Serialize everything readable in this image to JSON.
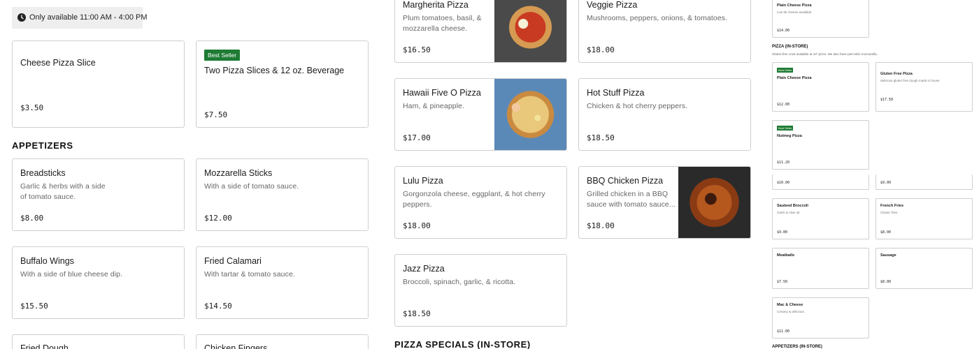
{
  "availability": {
    "text": "Only available 11:00 AM - 4:00 PM",
    "icon": "clock-icon"
  },
  "colors": {
    "badge_green": "#1e7b34",
    "border": "#cfcfcf",
    "availability_bg": "#eeeeee"
  },
  "specials": {
    "item1": {
      "name": "Cheese Pizza Slice",
      "price": "$3.50"
    },
    "item2": {
      "badge": "Best Seller",
      "name": "Two Pizza Slices & 12 oz. Beverage",
      "price": "$7.50"
    }
  },
  "appetizers": {
    "title": "APPETIZERS",
    "items": [
      {
        "name": "Breadsticks",
        "desc1": "Garlic & herbs with a side",
        "desc2": "of tomato sauce.",
        "price": "$8.00"
      },
      {
        "name": "Mozzarella Sticks",
        "desc1": "With a side of tomato sauce.",
        "price": "$12.00"
      },
      {
        "name": "Buffalo Wings",
        "desc1": "With a side of blue cheese dip.",
        "price": "$15.50"
      },
      {
        "name": "Fried Calamari",
        "desc1": "With tartar & tomato sauce.",
        "price": "$14.50"
      },
      {
        "name": "Fried Dough"
      },
      {
        "name": "Chicken Fingers"
      }
    ]
  },
  "pizzas": {
    "items": [
      {
        "name": "Margherita Pizza",
        "desc1": "Plum tomatoes, basil, &",
        "desc2": "mozzarella cheese.",
        "price": "$16.50"
      },
      {
        "name": "Veggie Pizza",
        "desc1": "Mushrooms, peppers, onions, & tomatoes.",
        "price": "$18.00"
      },
      {
        "name": "Hawaii Five O Pizza",
        "desc1": "Ham, & pineapple.",
        "price": "$17.00"
      },
      {
        "name": "Hot Stuff Pizza",
        "desc1": "Chicken & hot cherry peppers.",
        "price": "$18.50"
      },
      {
        "name": "Lulu Pizza",
        "desc1": "Gorgonzola cheese, eggplant, & hot cherry",
        "desc2": "peppers.",
        "price": "$18.00"
      },
      {
        "name": "BBQ Chicken Pizza",
        "desc1": "Grilled chicken in a BBQ",
        "desc2": "sauce with tomato sauce...",
        "price": "$18.00"
      },
      {
        "name": "Jazz Pizza",
        "desc1": "Broccoli, spinach, garlic, & ricotta.",
        "price": "$18.50"
      }
    ],
    "specials_title": "PIZZA SPECIALS (IN-STORE)"
  },
  "mini_panel": {
    "top": {
      "name": "Plain Cheese Pizza",
      "desc": "Low fat cheese available.",
      "price": "$14.00"
    },
    "section_title": "PIZZA (IN-STORE)",
    "section_sub": "Gluten-free crust available at 10\" pizza. We also have part-skim mozzarella.",
    "items": [
      {
        "badge": "Best Seller",
        "name": "Plain Cheese Pizza",
        "price": "$12.00"
      },
      {
        "name": "Gluten Free Pizza",
        "desc": "delicious gluten free dough made in house",
        "price": "$17.50"
      },
      {
        "badge": "Best Seller",
        "name": "Nutmeg Pizza",
        "price": "$11.20"
      },
      {
        "price": "$10.00"
      },
      {
        "price": "$9.00"
      },
      {
        "name": "Sauteed Broccoli",
        "desc": "Garlic & olive oil.",
        "price": "$9.00"
      },
      {
        "name": "French Fries",
        "desc": "Classic fries.",
        "price": "$8.00"
      },
      {
        "name": "Meatballs",
        "price": "$7.50"
      },
      {
        "name": "Sausage",
        "price": "$8.00"
      },
      {
        "name": "Mac & Cheese",
        "desc": "Creamy & delicious.",
        "price": "$11.00"
      }
    ],
    "bottom_title": "APPETIZERS (IN-STORE)"
  }
}
